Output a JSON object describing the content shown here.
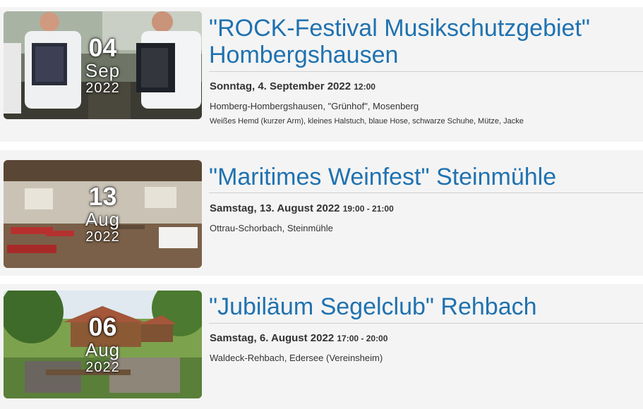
{
  "events": [
    {
      "day": "04",
      "month": "Sep",
      "year": "2022",
      "title_line1": "\"ROCK-Festival Musikschutzgebiet\"",
      "title_line2": "Hombergshausen",
      "date_label": "Sonntag, 4. September 2022",
      "time_label": "12:00",
      "location": "Homberg-Hombergshausen, \"Grünhof\", Mosenberg",
      "dress_code": "Weißes Hemd (kurzer Arm), kleines Halstuch, blaue Hose, schwarze Schuhe, Mütze, Jacke"
    },
    {
      "day": "13",
      "month": "Aug",
      "year": "2022",
      "title_line1": "\"Maritimes Weinfest\" Steinmühle",
      "date_label": "Samstag, 13. August 2022",
      "time_label": "19:00 - 21:00",
      "location": "Ottrau-Schorbach, Steinmühle"
    },
    {
      "day": "06",
      "month": "Aug",
      "year": "2022",
      "title_line1": "\"Jubiläum Segelclub\" Rehbach",
      "date_label": "Samstag, 6. August 2022",
      "time_label": "17:00 - 20:00",
      "location": "Waldeck-Rehbach, Edersee (Vereinsheim)"
    }
  ]
}
